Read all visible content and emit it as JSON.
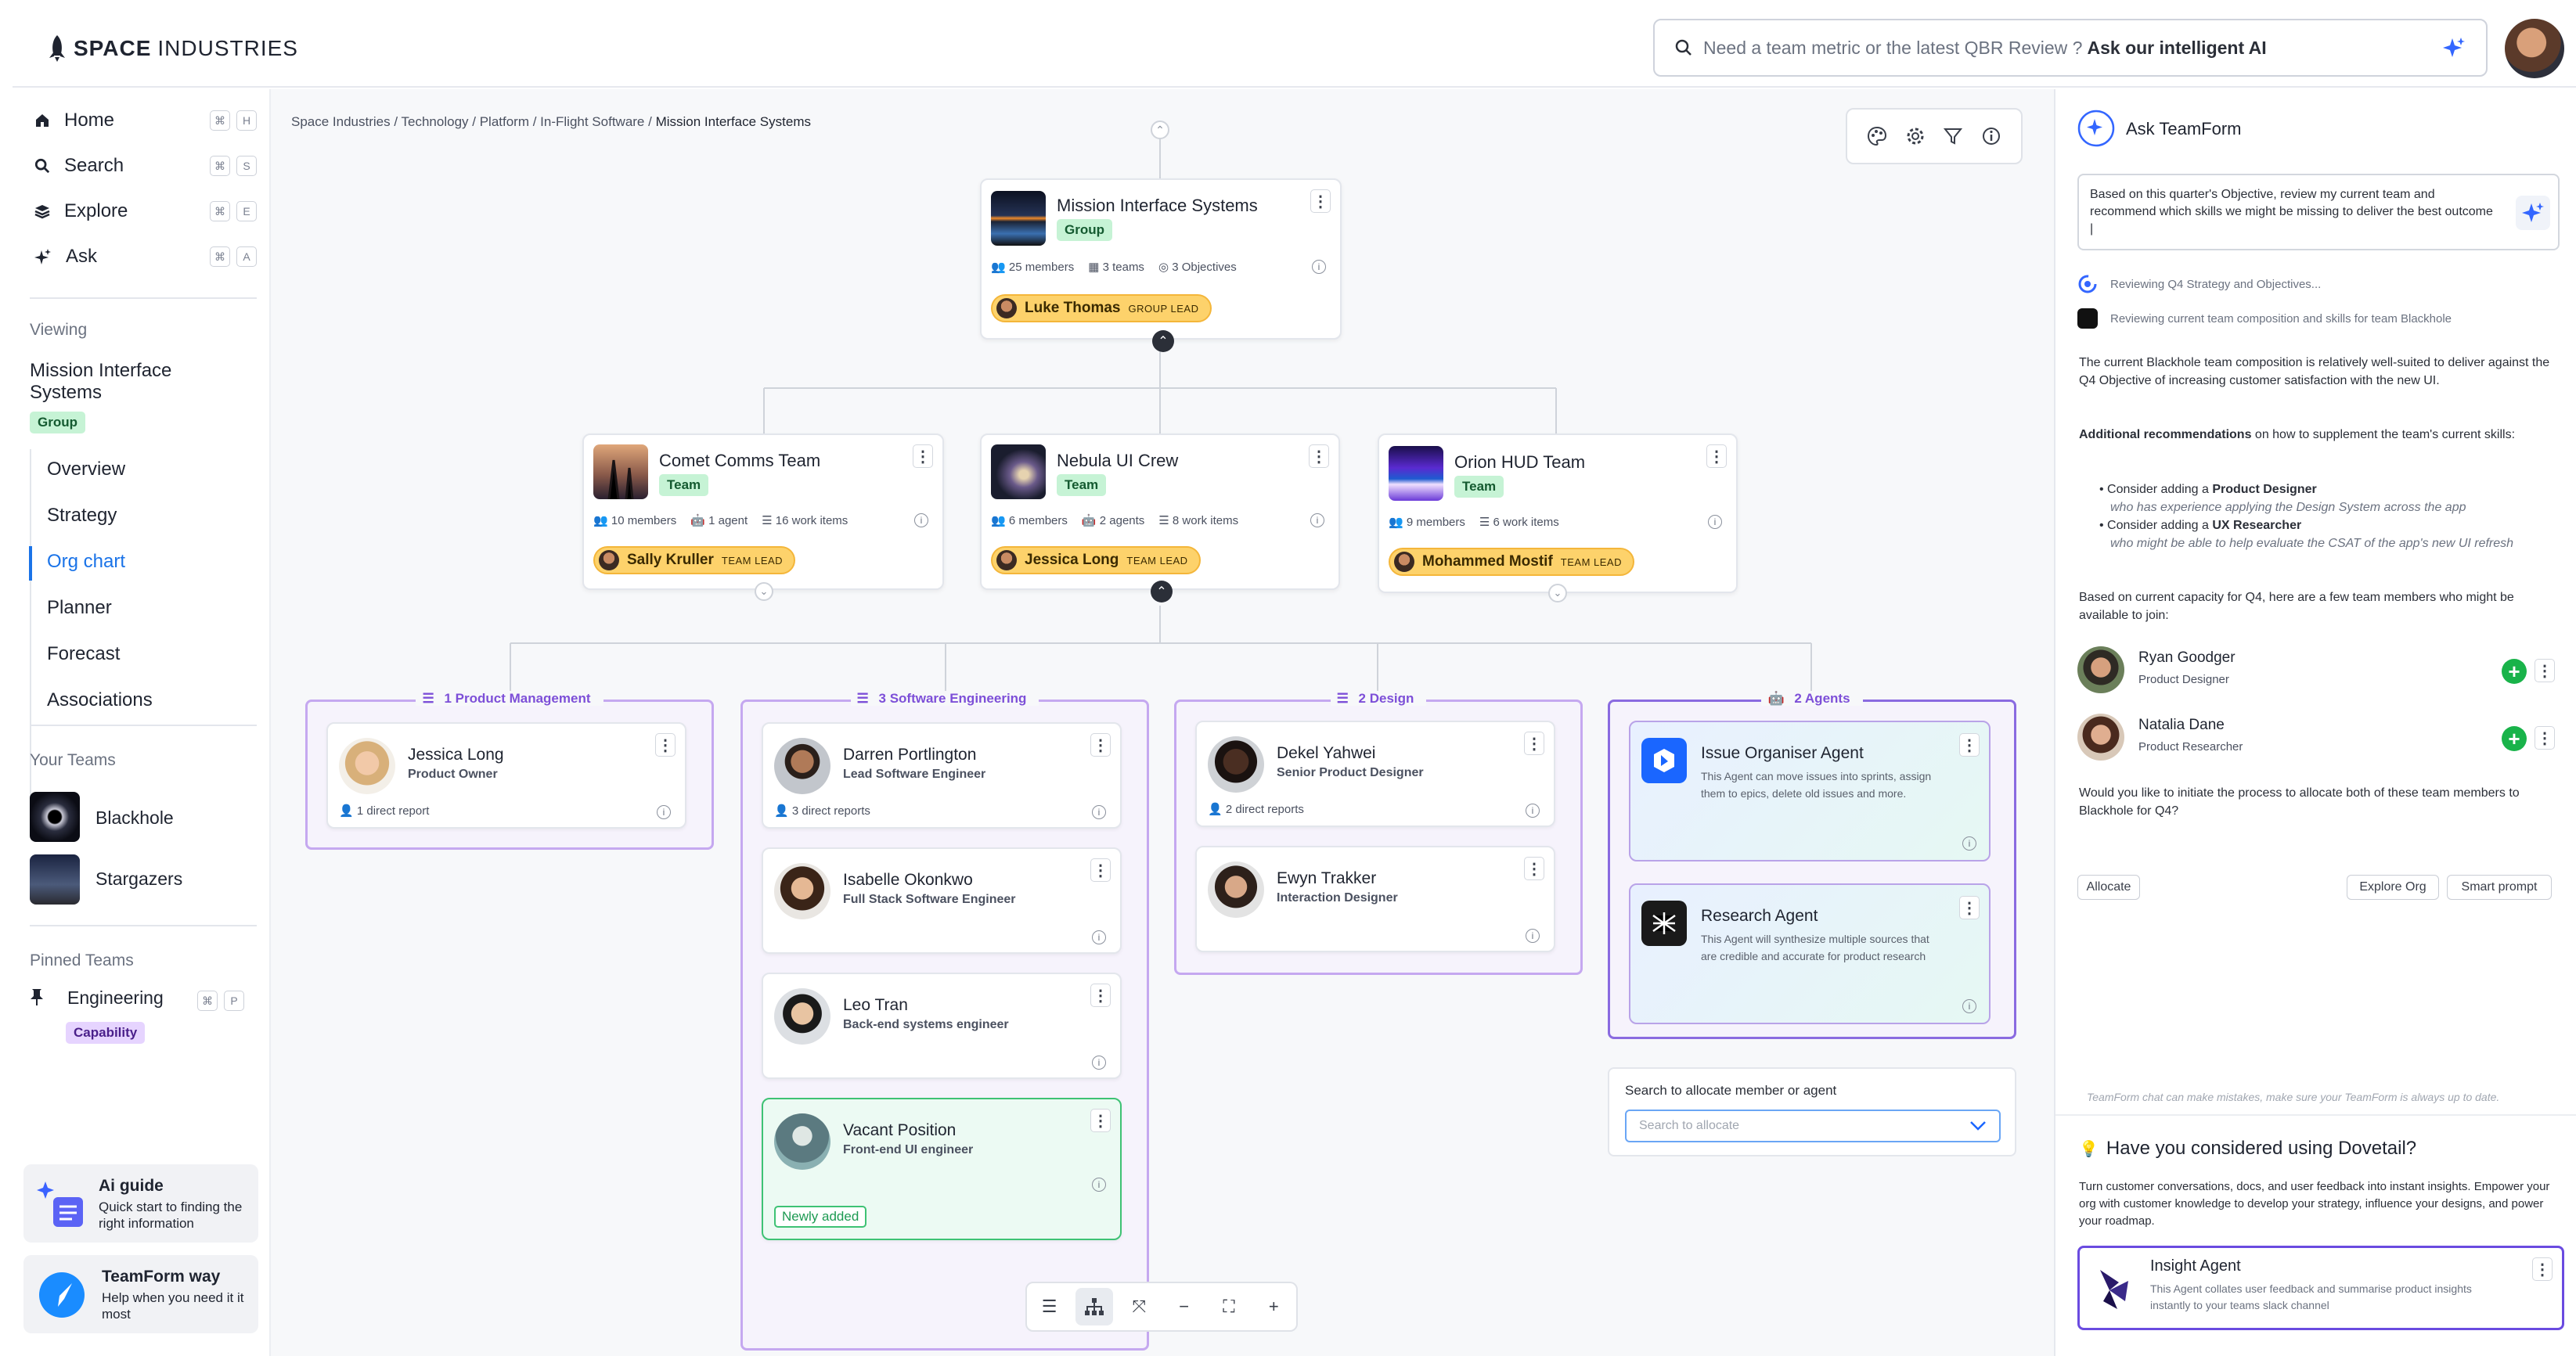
{
  "brand": {
    "name_bold": "SPACE",
    "name_rest": "INDUSTRIES"
  },
  "search": {
    "placeholder": "Need a team metric or the latest QBR Review ? ",
    "cta": "Ask our intelligent AI"
  },
  "sidebar": {
    "nav": [
      {
        "label": "Home",
        "keys": [
          "⌘",
          "H"
        ],
        "icon": "home-icon"
      },
      {
        "label": "Search",
        "keys": [
          "⌘",
          "S"
        ],
        "icon": "search-icon"
      },
      {
        "label": "Explore",
        "keys": [
          "⌘",
          "E"
        ],
        "icon": "layers-icon"
      },
      {
        "label": "Ask",
        "keys": [
          "⌘",
          "A"
        ],
        "icon": "sparkle-icon"
      }
    ],
    "viewing_label": "Viewing",
    "viewing_title": "Mission Interface Systems",
    "viewing_badge": "Group",
    "sub": [
      "Overview",
      "Strategy",
      "Org chart",
      "Planner",
      "Forecast",
      "Associations"
    ],
    "your_teams_label": "Your Teams",
    "your_teams": [
      "Blackhole",
      "Stargazers"
    ],
    "pinned_label": "Pinned Teams",
    "pinned": {
      "label": "Engineering",
      "badge": "Capability",
      "keys": [
        "⌘",
        "P"
      ]
    },
    "promo1": {
      "title": "Ai guide",
      "text": "Quick start to finding the right information"
    },
    "promo2": {
      "title": "TeamForm way",
      "text": "Help when you need it it most"
    }
  },
  "canvas": {
    "breadcrumb": [
      "Space Industries",
      "Technology",
      "Platform",
      "In-Flight Software",
      "Mission Interface Systems"
    ],
    "root": {
      "title": "Mission Interface Systems",
      "badge": "Group",
      "members": "25 members",
      "teams": "3 teams",
      "objectives": "3 Objectives",
      "lead": "Luke Thomas",
      "lead_tag": "GROUP LEAD"
    },
    "teams": [
      {
        "title": "Comet Comms Team",
        "badge": "Team",
        "members": "10 members",
        "agents": "1 agent",
        "work": "16 work items",
        "lead": "Sally Kruller",
        "lead_tag": "TEAM LEAD"
      },
      {
        "title": "Nebula UI Crew",
        "badge": "Team",
        "members": "6 members",
        "agents": "2 agents",
        "work": "8 work items",
        "lead": "Jessica Long",
        "lead_tag": "TEAM LEAD"
      },
      {
        "title": "Orion HUD Team",
        "badge": "Team",
        "members": "9 members",
        "agents": "",
        "work": "6 work items",
        "lead": "Mohammed Mostif",
        "lead_tag": "TEAM LEAD"
      }
    ],
    "columns": [
      {
        "head": "1 Product Management",
        "people": [
          {
            "name": "Jessica Long",
            "role": "Product Owner",
            "reports": "1 direct report"
          }
        ]
      },
      {
        "head": "3 Software Engineering",
        "people": [
          {
            "name": "Darren Portlington",
            "role": "Lead Software Engineer",
            "reports": "3 direct reports"
          },
          {
            "name": "Isabelle Okonkwo",
            "role": "Full Stack Software Engineer",
            "reports": ""
          },
          {
            "name": "Leo Tran",
            "role": "Back-end systems engineer",
            "reports": ""
          },
          {
            "name": "Vacant Position",
            "role": "Front-end UI engineer",
            "reports": "",
            "tag": "Newly added"
          }
        ]
      },
      {
        "head": "2 Design",
        "people": [
          {
            "name": "Dekel Yahwei",
            "role": "Senior Product Designer",
            "reports": "2 direct reports"
          },
          {
            "name": "Ewyn Trakker",
            "role": "Interaction Designer",
            "reports": ""
          }
        ]
      },
      {
        "head": "2 Agents",
        "agents": [
          {
            "name": "Issue Organiser Agent",
            "desc": "This Agent can move issues into sprints, assign them to epics, delete old issues and more."
          },
          {
            "name": "Research Agent",
            "desc": "This Agent will synthesize multiple sources that are credible and accurate for product research"
          }
        ]
      }
    ],
    "allocate": {
      "label": "Search to allocate member or agent",
      "placeholder": "Search to allocate"
    }
  },
  "panel": {
    "title": "Ask TeamForm",
    "prompt": "Based on this quarter's Objective, review my current team and recommend which skills we might be missing to deliver the best outcome |",
    "steps": [
      "Reviewing Q4 Strategy and Objectives...",
      "Reviewing current team composition and skills for team Blackhole"
    ],
    "p1": "The current Blackhole team composition is relatively well-suited to deliver against the Q4 Objective of increasing customer satisfaction with the new UI.",
    "rec_bold": "Additional recommendations",
    "rec_rest": " on how to supplement the team's current skills:",
    "b1_pre": "Consider adding a ",
    "b1_bold": "Product Designer",
    "b1_note": "who has experience applying the Design System across the app",
    "b2_pre": "Consider adding a ",
    "b2_bold": "UX Researcher",
    "b2_note": "who might be able to help evaluate the CSAT of the app's new UI refresh",
    "p2": "Based on current capacity for Q4, here are a few team members who might be available to join:",
    "people": [
      {
        "name": "Ryan Goodger",
        "role": "Product Designer"
      },
      {
        "name": "Natalia Dane",
        "role": "Product Researcher"
      }
    ],
    "p3": "Would you like to initiate the process to allocate both of these team members to Blackhole for Q4?",
    "buttons": {
      "allocate": "Allocate",
      "explore": "Explore Org",
      "smart": "Smart prompt"
    },
    "disclaimer": "TeamForm chat can make mistakes, make sure your TeamForm is always up to date.",
    "dovetail_title": "Have you considered using Dovetail?",
    "dovetail_text": "Turn customer conversations, docs, and user feedback into instant insights. Empower your org with customer knowledge to develop your strategy, influence your designs, and power your roadmap.",
    "insight": {
      "name": "Insight Agent",
      "desc": "This Agent collates user feedback and summarise product insights instantly to your teams slack channel"
    }
  }
}
